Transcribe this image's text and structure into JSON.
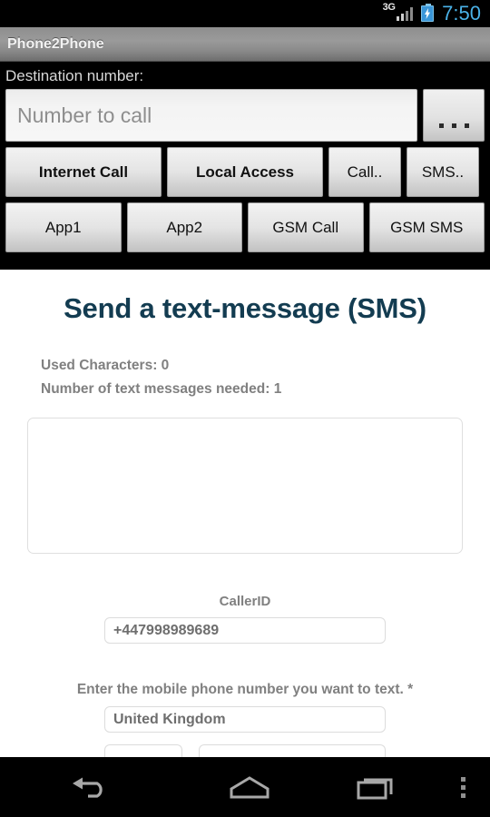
{
  "statusbar": {
    "network_label": "3G",
    "signal_icon": "signal-bars-icon",
    "battery_icon": "battery-charging-icon",
    "clock": "7:50",
    "clock_color": "#4ab2e8"
  },
  "titlebar": {
    "app_title": "Phone2Phone"
  },
  "destination": {
    "label": "Destination number:",
    "placeholder": "Number to call",
    "value": "",
    "more_button_label": "...",
    "more_button_icon": "ellipsis-icon"
  },
  "action_buttons": {
    "row1": [
      {
        "label": "Internet Call",
        "bold": true
      },
      {
        "label": "Local Access",
        "bold": true
      },
      {
        "label": "Call..",
        "bold": false
      },
      {
        "label": "SMS..",
        "bold": false
      }
    ],
    "row2": [
      {
        "label": "App1",
        "bold": false
      },
      {
        "label": "App2",
        "bold": false
      },
      {
        "label": "GSM Call",
        "bold": false
      },
      {
        "label": "GSM SMS",
        "bold": false
      }
    ]
  },
  "page": {
    "heading": "Send a text-message (SMS)",
    "heading_color": "#133c51",
    "used_characters": "Used Characters: 0",
    "messages_needed": "Number of text messages needed: 1",
    "message_textarea": {
      "value": "",
      "placeholder": ""
    },
    "callerid": {
      "label": "CallerID",
      "value": "+447998989689"
    },
    "mobile_number": {
      "label": "Enter the mobile phone number you want to text. *",
      "country_value": "United Kingdom",
      "prefix_value": "",
      "number_value": ""
    }
  },
  "navbar": {
    "back_icon": "back-arrow-icon",
    "home_icon": "home-icon",
    "recents_icon": "recent-apps-icon",
    "menu_icon": "overflow-menu-icon"
  }
}
